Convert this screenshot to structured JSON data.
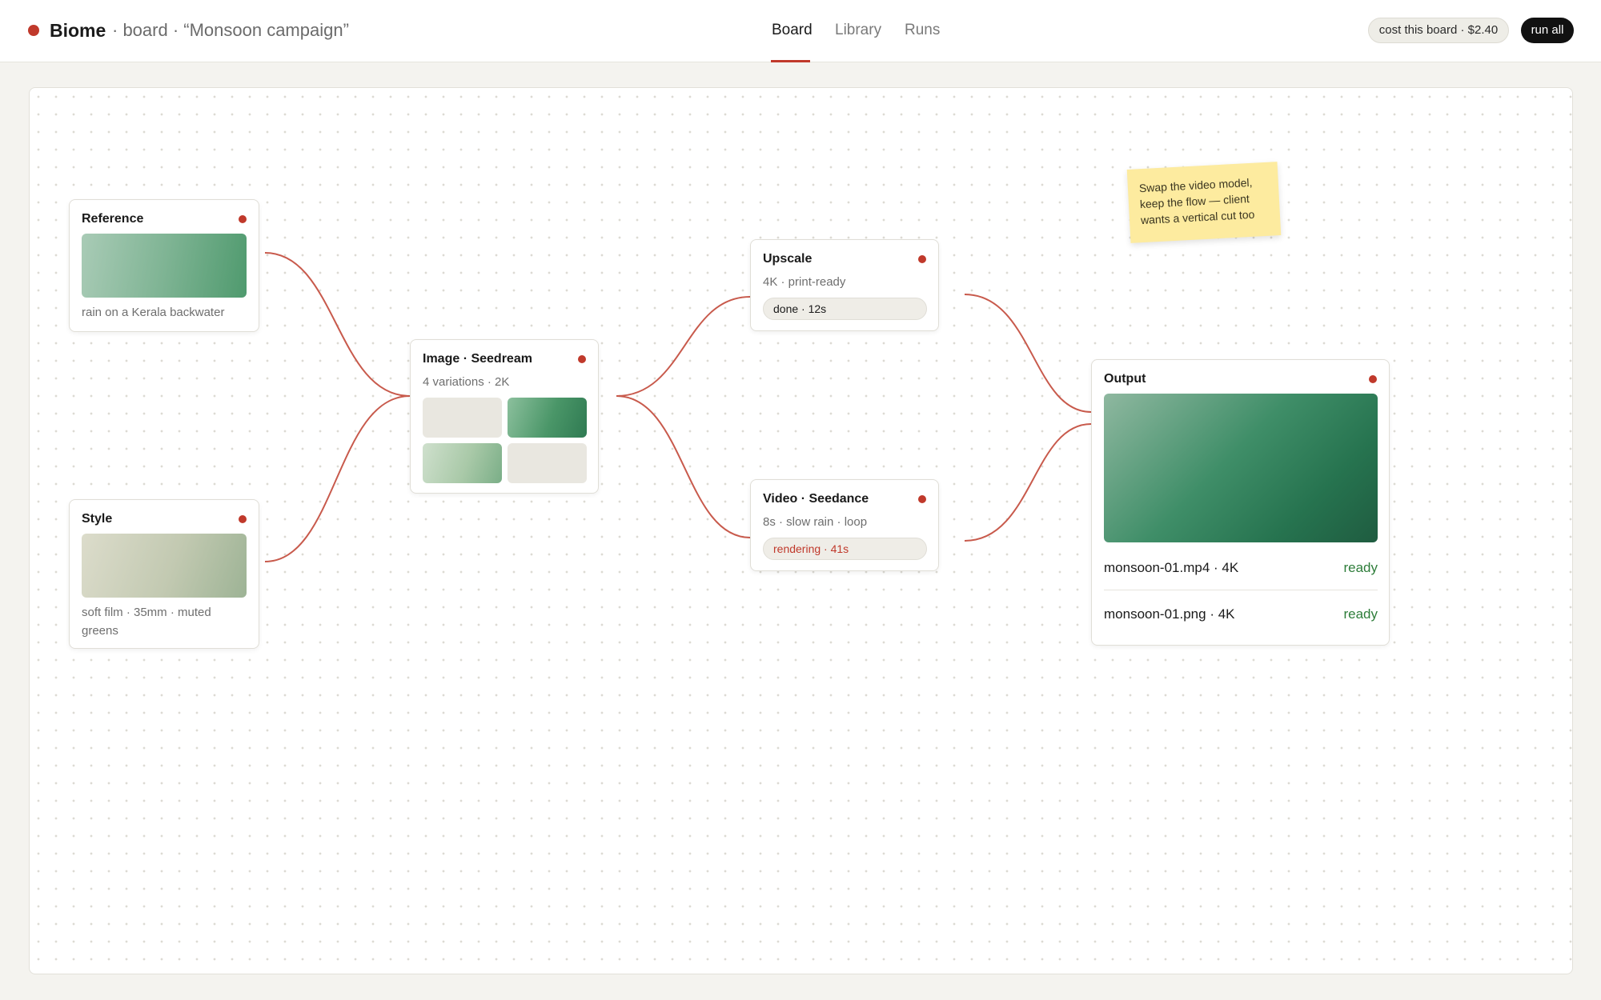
{
  "app": {
    "name": "Biome",
    "crumb": "· board · “Monsoon campaign”",
    "brand_color": "#c0392b"
  },
  "nav": {
    "tabs": [
      {
        "label": "Board",
        "active": true
      },
      {
        "label": "Library",
        "active": false
      },
      {
        "label": "Runs",
        "active": false
      }
    ]
  },
  "toolbar": {
    "cost_label": "cost this board · $2.40",
    "run_label": "run all"
  },
  "nodes": {
    "reference": {
      "title": "Reference",
      "caption": "rain on a Kerala backwater",
      "status_color": "#c0392b"
    },
    "style": {
      "title": "Style",
      "caption": "soft film · 35mm · muted greens",
      "status_color": "#c0392b"
    },
    "image": {
      "title": "Image · Seedream",
      "subtitle": "4 variations · 2K",
      "status_color": "#c0392b"
    },
    "upscale": {
      "title": "Upscale",
      "subtitle": "4K · print-ready",
      "status": "done · 12s"
    },
    "video": {
      "title": "Video · Seedance",
      "subtitle": "8s · slow rain · loop",
      "status": "rendering · 41s"
    },
    "output": {
      "title": "Output",
      "files": [
        {
          "name": "monsoon-01.mp4 · 4K",
          "state": "ready"
        },
        {
          "name": "monsoon-01.png · 4K",
          "state": "ready"
        }
      ]
    }
  },
  "sticky_note": {
    "text": "Swap the video model, keep the flow — client wants a vertical cut too"
  },
  "colors": {
    "edge": "#c85a4c",
    "ready": "#2e7d3a",
    "rendering": "#c0392b"
  }
}
